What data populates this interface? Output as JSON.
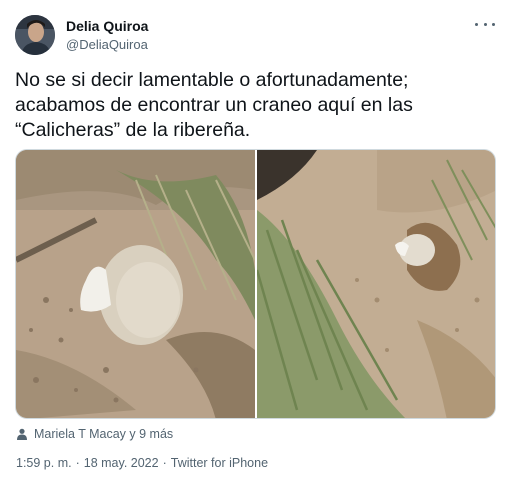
{
  "author": {
    "name": "Delia Quiroa",
    "handle": "@DeliaQuiroa",
    "avatar": "profile-photo"
  },
  "menu": {
    "icon": "more-dots-icon"
  },
  "tweet": {
    "lines": [
      "No se si decir lamentable o afortunadamente;",
      "acabamos de encontrar un craneo aquí en las",
      "“Calicheras” de la ribereña."
    ]
  },
  "media": {
    "photos": [
      {
        "subject": "skull-in-dirt-closeup"
      },
      {
        "subject": "skull-in-grass-wide"
      }
    ]
  },
  "tagged": {
    "icon": "person-icon",
    "text": "Mariela T Macay y 9 más"
  },
  "meta": {
    "time": "1:59 p. m.",
    "date": "18 may. 2022",
    "source": "Twitter for iPhone",
    "separator": "·"
  },
  "colors": {
    "text": "#0f1419",
    "secondary": "#536471",
    "border": "#cfd9de"
  }
}
